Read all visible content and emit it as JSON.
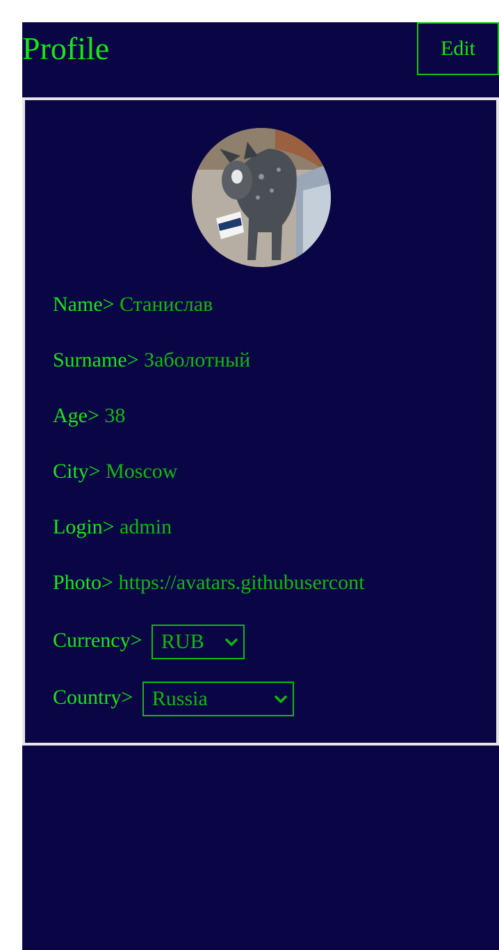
{
  "header": {
    "title": "Profile",
    "edit_label": "Edit"
  },
  "profile": {
    "avatar_icon": "dog-photo-avatar",
    "fields": [
      {
        "label": "Name>",
        "value": "Станислав"
      },
      {
        "label": "Surname>",
        "value": "Заболотный"
      },
      {
        "label": "Age>",
        "value": "38"
      },
      {
        "label": "City>",
        "value": "Moscow"
      },
      {
        "label": "Login>",
        "value": "admin"
      },
      {
        "label": "Photo>",
        "value": "https://avatars.githubusercont"
      }
    ],
    "currency": {
      "label": "Currency>",
      "selected": "RUB"
    },
    "country": {
      "label": "Country>",
      "selected": "Russia"
    }
  },
  "colors": {
    "background": "#0a0645",
    "accent": "#17e617",
    "value_text": "#11b811",
    "card_border": "#e6e6e6"
  }
}
